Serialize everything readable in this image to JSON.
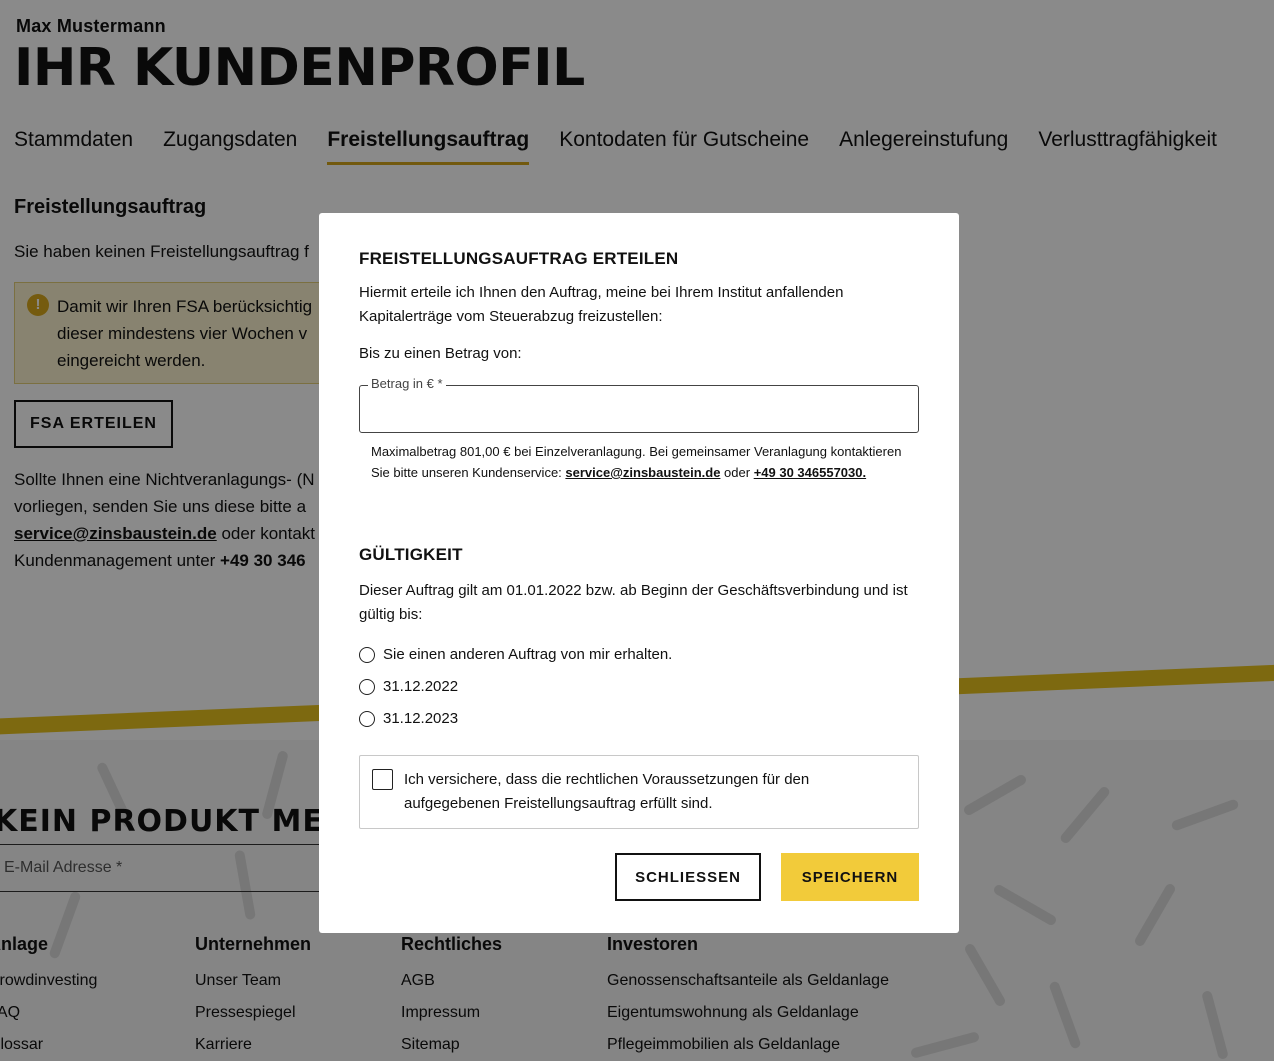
{
  "header": {
    "user_name": "Max Mustermann",
    "title": "IHR KUNDENPROFIL"
  },
  "tabs": [
    {
      "label": "Stammdaten",
      "active": false
    },
    {
      "label": "Zugangsdaten",
      "active": false
    },
    {
      "label": "Freistellungsauftrag",
      "active": true
    },
    {
      "label": "Kontodaten für Gutscheine",
      "active": false
    },
    {
      "label": "Anlegereinstufung",
      "active": false
    },
    {
      "label": "Verlusttragfähigkeit",
      "active": false
    }
  ],
  "content": {
    "heading": "Freistellungsauftrag",
    "intro": "Sie haben keinen Freistellungsauftrag f",
    "notice_lines": [
      "Damit wir Ihren FSA berücksichtig",
      "dieser mindestens vier Wochen v",
      "eingereicht werden."
    ],
    "fsa_button": "FSA ERTEILEN",
    "info_line_1": "Sollte Ihnen eine Nichtveranlagungs- (N",
    "info_line_2": "vorliegen, senden Sie uns diese bitte a",
    "info_email": "service@zinsbaustein.de",
    "info_line_3_rest": " oder kontakt",
    "info_line_4": "Kundenmanagement unter ",
    "info_phone": "+49 30 346"
  },
  "newsletter": {
    "heading": "KEIN PRODUKT MEHR",
    "email_placeholder": "E-Mail Adresse *"
  },
  "footer": {
    "columns": [
      {
        "heading": "Anlage",
        "links": [
          "Crowdinvesting",
          "FAQ",
          "Glossar"
        ]
      },
      {
        "heading": "Unternehmen",
        "links": [
          "Unser Team",
          "Pressespiegel",
          "Karriere"
        ]
      },
      {
        "heading": "Rechtliches",
        "links": [
          "AGB",
          "Impressum",
          "Sitemap"
        ]
      },
      {
        "heading": "Investoren",
        "links": [
          "Genossenschaftsanteile als Geldanlage",
          "Eigentumswohnung als Geldanlage",
          "Pflegeimmobilien als Geldanlage"
        ]
      }
    ]
  },
  "modal": {
    "title": "FREISTELLUNGSAUFTRAG ERTEILEN",
    "description": "Hiermit erteile ich Ihnen den Auftrag, meine bei Ihrem Institut anfallenden Kapitalerträge vom Steuerabzug freizustellen:",
    "amount_label": "Bis zu einen Betrag von:",
    "amount_field_label": "Betrag in € *",
    "amount_value": "",
    "help_text": "Maximalbetrag 801,00 € bei Einzelveranlagung. Bei gemeinsamer Veranlagung kontaktieren Sie bitte unseren Kundenservice: ",
    "help_email": "service@zinsbaustein.de",
    "help_or": " oder ",
    "help_phone": "+49 30 346557030.",
    "validity_title": "GÜLTIGKEIT",
    "validity_text": "Dieser Auftrag gilt am 01.01.2022 bzw. ab Beginn der Geschäftsverbindung und ist gültig bis:",
    "options": [
      "Sie einen anderen Auftrag von mir erhalten.",
      "31.12.2022",
      "31.12.2023"
    ],
    "confirmation_text": "Ich versichere, dass die rechtlichen Voraussetzungen für den aufgegebenen Freistellungsauftrag erfüllt sind.",
    "close_button": "SCHLIESSEN",
    "save_button": "SPEICHERN"
  },
  "colors": {
    "accent": "#f2cb3a",
    "tab_underline": "#d3a51b",
    "notice_bg": "#fbf3cf",
    "overlay": "rgba(0,0,0,0.46)"
  }
}
